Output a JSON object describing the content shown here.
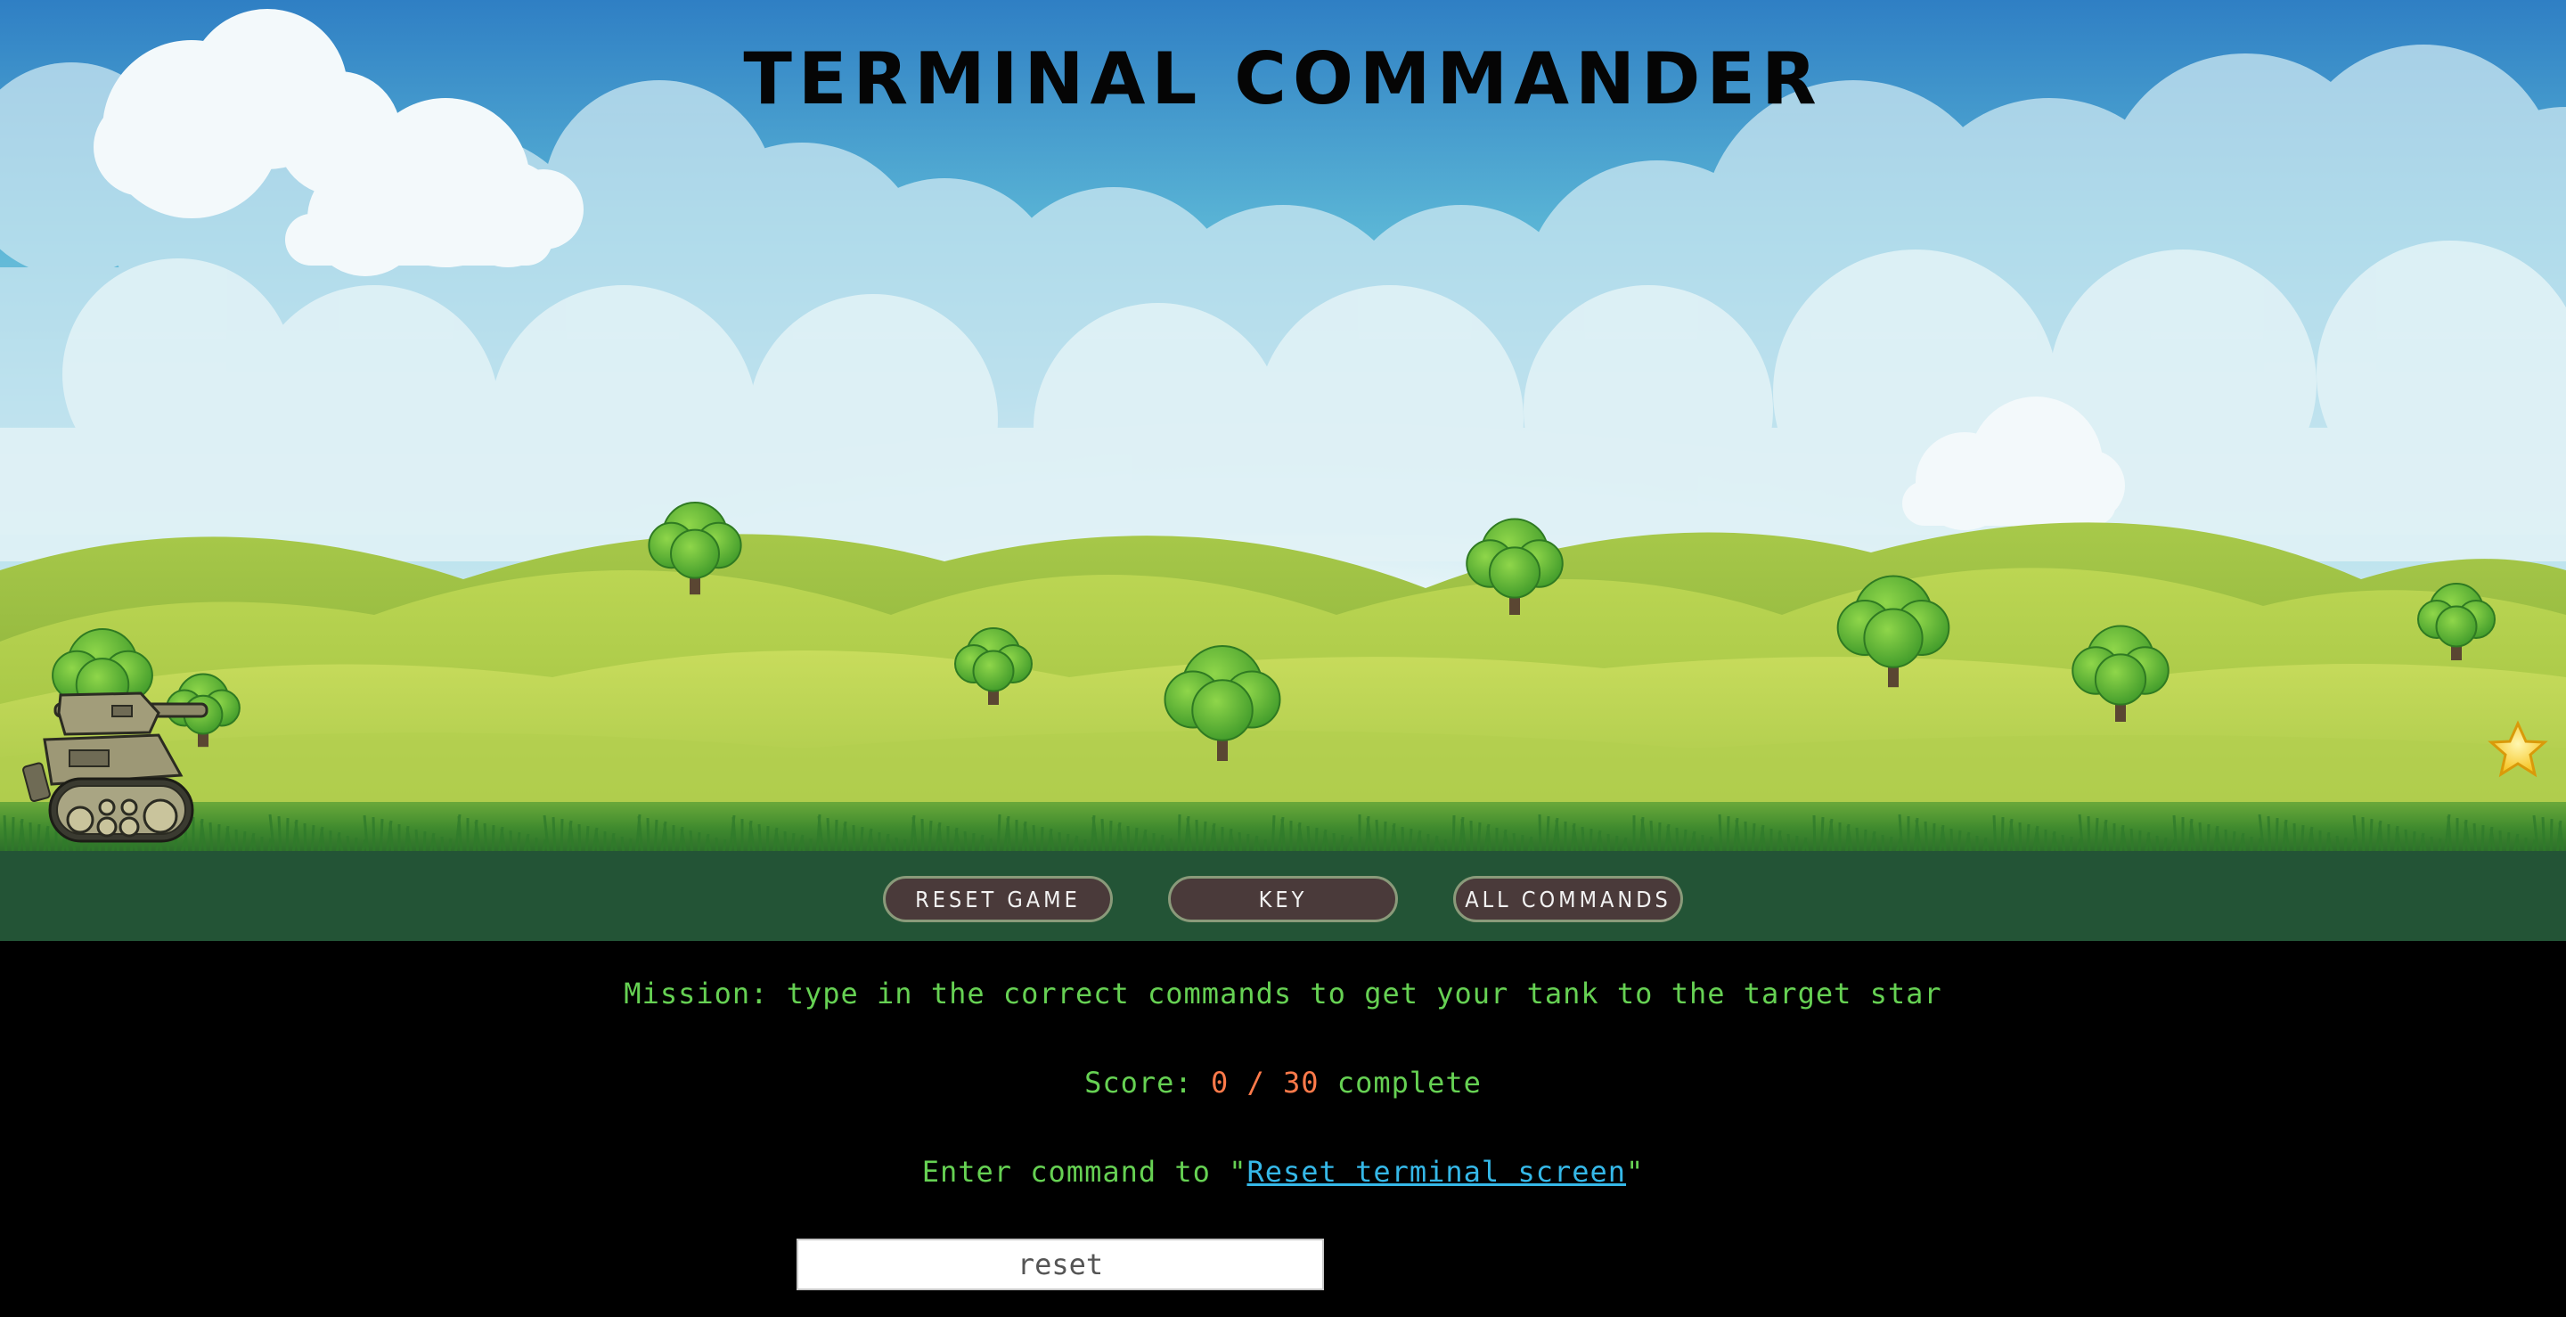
{
  "game": {
    "title": "TERMINAL COMMANDER"
  },
  "scene": {
    "sprites": [
      "tank-sprite",
      "target-star-icon",
      "tree-icon",
      "cloud-icon"
    ],
    "colors": {
      "sky_top": "#2f7fc4",
      "sky_bottom": "#e6f4f6",
      "hills": "#9cc23c",
      "grass": "#3f8a2e",
      "ground_band": "#235436",
      "star": "#f6c21c"
    }
  },
  "buttons": {
    "reset_label": "RESET GAME",
    "key_label": "KEY",
    "all_commands_label": "ALL COMMANDS"
  },
  "terminal": {
    "mission_text": "Mission: type in the correct commands to get your tank to the target star",
    "score_prefix": "Score: ",
    "score_current": "0",
    "score_separator": " / ",
    "score_total": "30",
    "score_suffix": " complete",
    "prompt_prefix": "Enter command to \"",
    "prompt_task": "Reset terminal screen",
    "prompt_suffix": "\"",
    "input_value": "reset",
    "colors": {
      "text": "#66d153",
      "score_highlight": "#ff7a4a",
      "link": "#35b8e8"
    }
  }
}
